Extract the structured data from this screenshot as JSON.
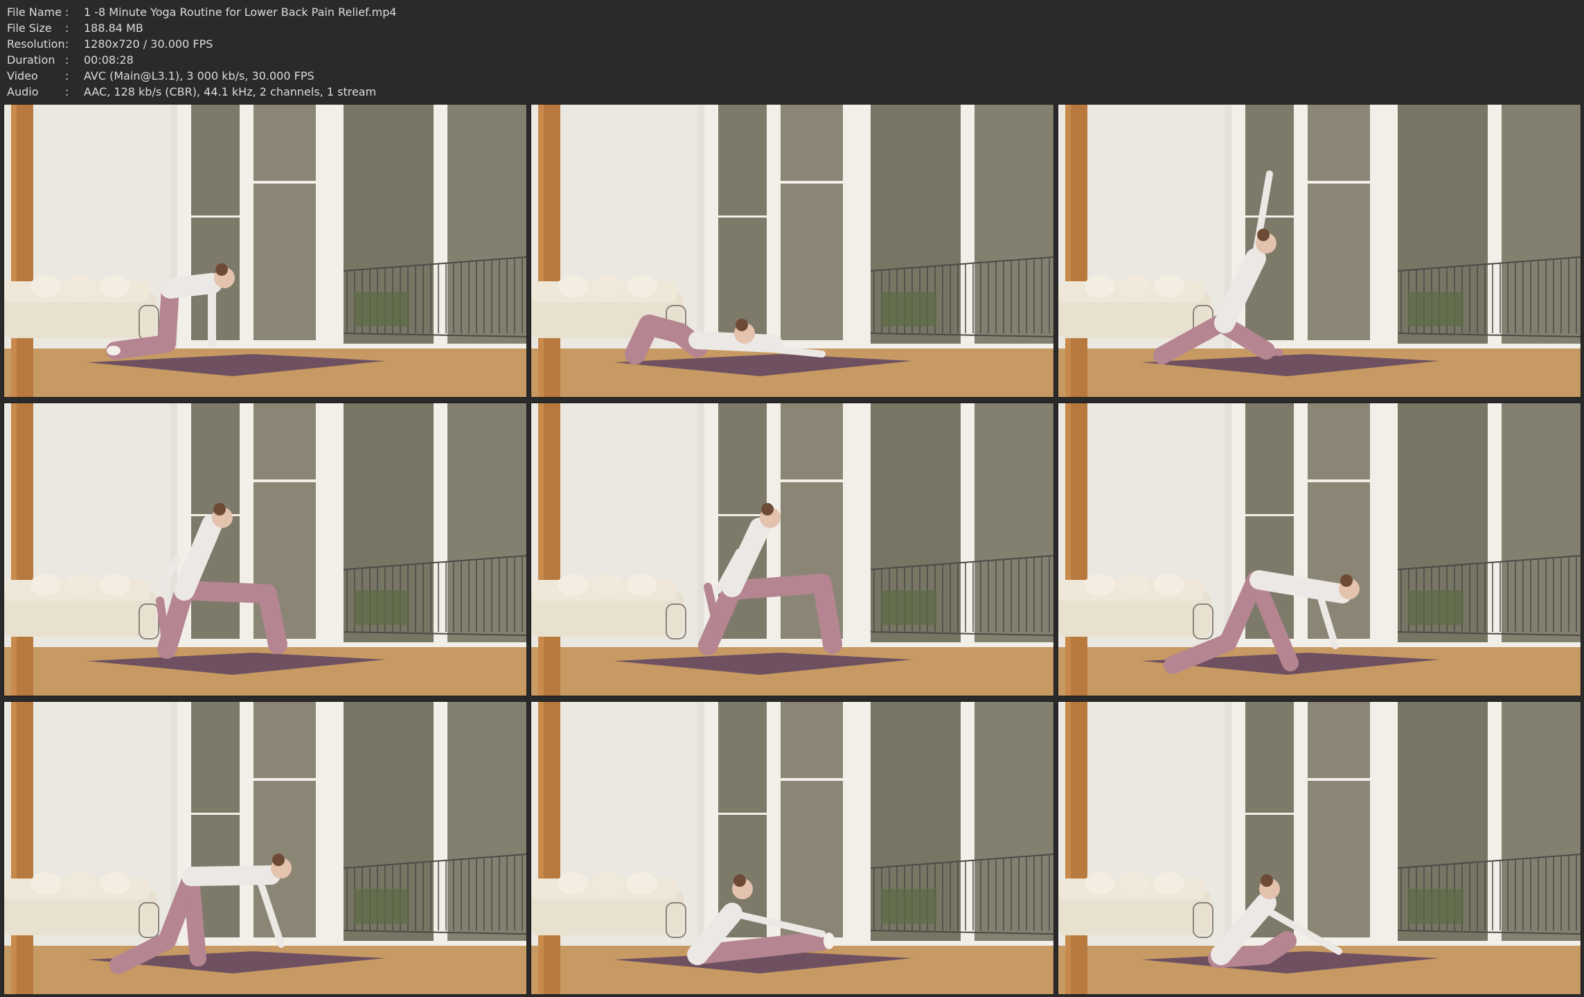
{
  "file_info": [
    {
      "label": "File Name",
      "sep": ":",
      "value": "1 -8 Minute Yoga Routine for Lower Back Pain Relief.mp4"
    },
    {
      "label": "File Size",
      "sep": ":",
      "value": "188.84 MB"
    },
    {
      "label": "Resolution",
      "sep": ":",
      "value": "1280x720 / 30.000 FPS"
    },
    {
      "label": "Duration",
      "sep": ":",
      "value": "00:08:28"
    },
    {
      "label": "Video",
      "sep": ":",
      "value": "AVC (Main@L3.1), 3 000 kb/s, 30.000 FPS"
    },
    {
      "label": "Audio",
      "sep": ":",
      "value": "AAC, 128 kb/s (CBR), 44.1 kHz, 2 channels, 1 stream"
    }
  ],
  "thumbnails": [
    {
      "pose": "tabletop"
    },
    {
      "pose": "child"
    },
    {
      "pose": "low-lunge-arm-up"
    },
    {
      "pose": "kneeling-quad-stretch"
    },
    {
      "pose": "kneeling-quad-stretch-side"
    },
    {
      "pose": "half-split"
    },
    {
      "pose": "half-split-reach"
    },
    {
      "pose": "seated-forward-fold"
    },
    {
      "pose": "seated-twist"
    }
  ],
  "colors": {
    "background": "#2a2a2a",
    "text": "#dcdcdc",
    "wall": "#e4e1da",
    "floor": "#c79a63",
    "frame": "#f2efe9",
    "beam": "#b7793e",
    "forest": "#7d7a6a",
    "mat": "#6e5060",
    "leggings": "#b58592",
    "top": "#ece8e6"
  }
}
